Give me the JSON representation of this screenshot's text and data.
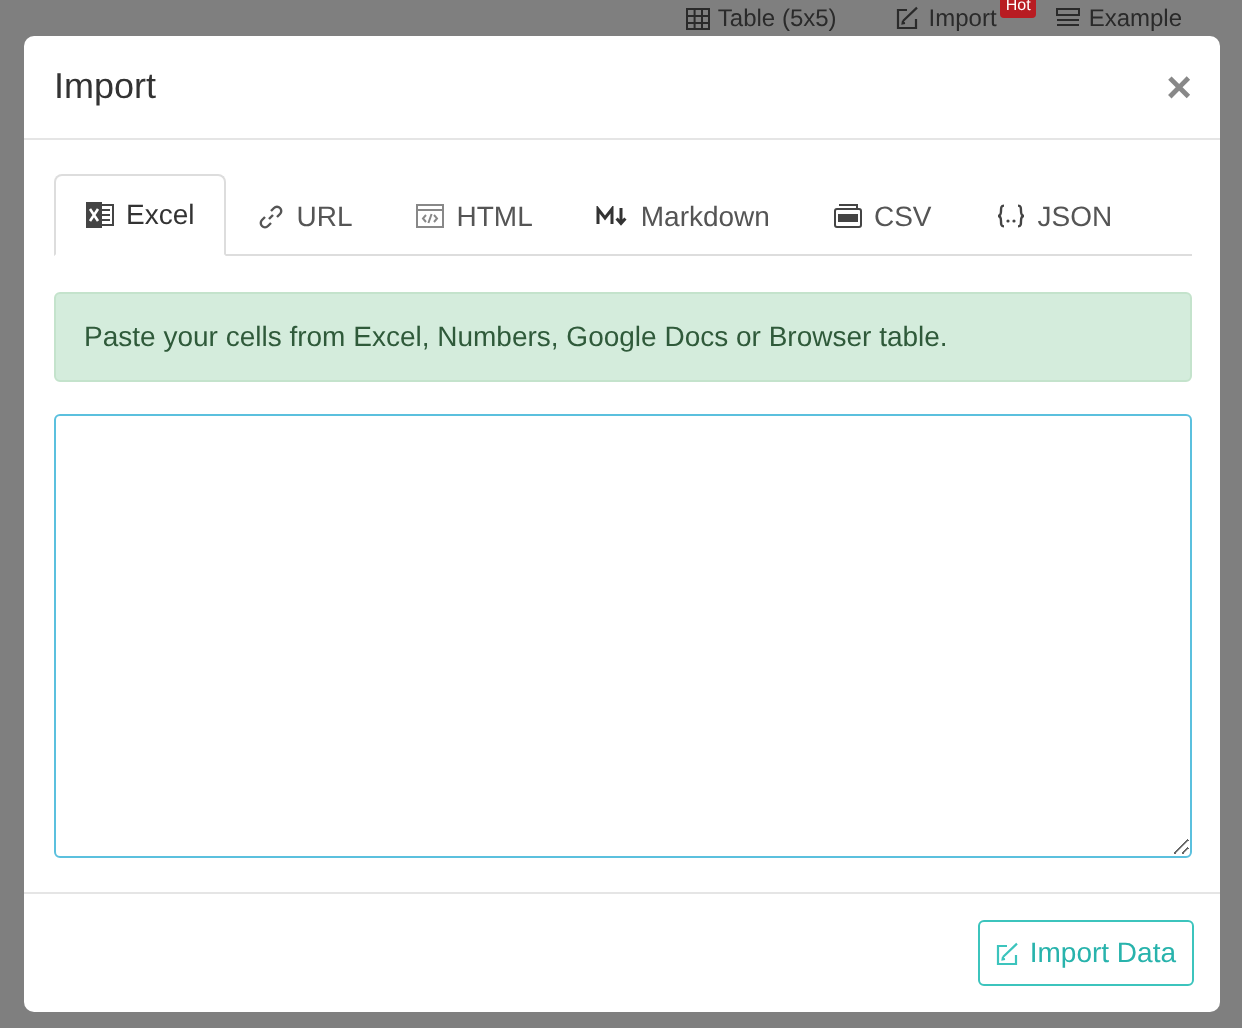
{
  "background_toolbar": [
    {
      "label": "Table (5x5)"
    },
    {
      "label": "Import",
      "badge": "Hot"
    },
    {
      "label": "Example"
    }
  ],
  "dialog": {
    "title": "Import",
    "close": "×",
    "tabs": [
      {
        "label": "Excel",
        "selected": true
      },
      {
        "label": "URL",
        "selected": false
      },
      {
        "label": "HTML",
        "selected": false
      },
      {
        "label": "Markdown",
        "selected": false
      },
      {
        "label": "CSV",
        "selected": false
      },
      {
        "label": "JSON",
        "selected": false
      }
    ],
    "notice": "Paste your cells from Excel, Numbers, Google Docs or Browser table.",
    "button": "Import Data"
  }
}
